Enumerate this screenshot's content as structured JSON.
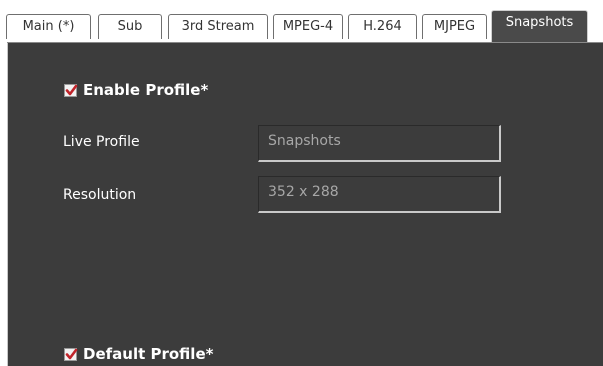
{
  "tabs": [
    {
      "label": "Main (*)",
      "active": false
    },
    {
      "label": "Sub",
      "active": false
    },
    {
      "label": "3rd Stream",
      "active": false
    },
    {
      "label": "MPEG-4",
      "active": false
    },
    {
      "label": "H.264",
      "active": false
    },
    {
      "label": "MJPEG",
      "active": false
    },
    {
      "label": "Snapshots",
      "active": true
    }
  ],
  "profile": {
    "enable_label": "Enable Profile*",
    "enable_checked": true,
    "live_profile_label": "Live Profile",
    "live_profile_value": "Snapshots",
    "resolution_label": "Resolution",
    "resolution_value": "352 x 288",
    "default_label": "Default Profile*",
    "default_checked": true
  },
  "colors": {
    "panel_bg": "#3c3c3c",
    "active_tab_bg": "#4a4a4a",
    "check_mark": "#c0242b",
    "field_text": "#a7a7a7"
  },
  "icons": {
    "check": "check-icon"
  }
}
